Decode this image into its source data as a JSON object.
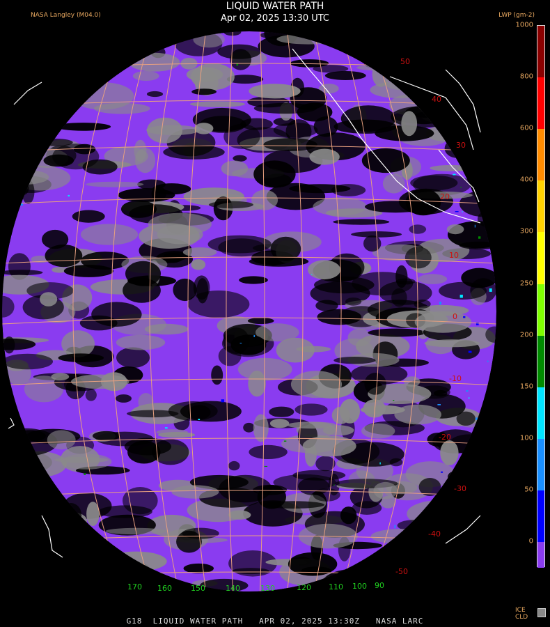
{
  "header": {
    "title": "LIQUID WATER PATH",
    "subtitle": "Apr 02, 2025 13:30 UTC",
    "source": "NASA Langley (M04.0)",
    "units": "LWP (gm-2)"
  },
  "legend": {
    "ticks": [
      "1000",
      "800",
      "600",
      "400",
      "300",
      "250",
      "200",
      "150",
      "100",
      "50",
      "0"
    ],
    "colors": [
      "#8a0000",
      "#ff0000",
      "#ff8c00",
      "#ffd200",
      "#ffff00",
      "#7fff00",
      "#008c00",
      "#00e5ff",
      "#1a90ff",
      "#0000ff",
      "#8a3cf0"
    ],
    "ice_label": "ICE",
    "cld_label": "CLD",
    "cld_color": "#8a8a8a"
  },
  "map": {
    "lat_labels_right": [
      "50",
      "40",
      "30",
      "20",
      "10",
      "0",
      "-10",
      "-20",
      "-30",
      "-40",
      "-50"
    ],
    "lon_labels_bottom": [
      "170",
      "160",
      "150",
      "140",
      "130",
      "120",
      "110",
      "100",
      "90"
    ],
    "colors": {
      "ocean": "#000000",
      "cloud_gray": "#8a8a8a",
      "lwp_low": "#8a3cf0",
      "grid": "#e8a080",
      "coast": "#ffffff",
      "lat_label": "#d01010",
      "lon_label": "#20d020"
    }
  },
  "footer": {
    "text": "G18  LIQUID WATER PATH   APR 02, 2025 13:30Z   NASA LARC"
  }
}
